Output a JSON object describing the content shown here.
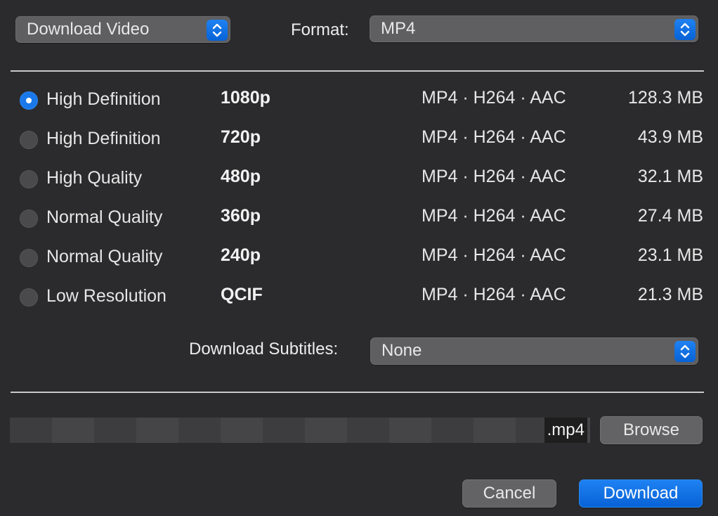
{
  "header": {
    "action_selected": "Download Video",
    "format_label": "Format:",
    "format_selected": "MP4"
  },
  "options": [
    {
      "quality": "High Definition",
      "resolution": "1080p",
      "codec": "MP4 · H264 · AAC",
      "size": "128.3 MB",
      "selected": true
    },
    {
      "quality": "High Definition",
      "resolution": "720p",
      "codec": "MP4 · H264 · AAC",
      "size": "43.9 MB",
      "selected": false
    },
    {
      "quality": "High Quality",
      "resolution": "480p",
      "codec": "MP4 · H264 · AAC",
      "size": "32.1 MB",
      "selected": false
    },
    {
      "quality": "Normal Quality",
      "resolution": "360p",
      "codec": "MP4 · H264 · AAC",
      "size": "27.4 MB",
      "selected": false
    },
    {
      "quality": "Normal Quality",
      "resolution": "240p",
      "codec": "MP4 · H264 · AAC",
      "size": "23.1 MB",
      "selected": false
    },
    {
      "quality": "Low Resolution",
      "resolution": "QCIF",
      "codec": "MP4 · H264 · AAC",
      "size": "21.3 MB",
      "selected": false
    }
  ],
  "subtitles": {
    "label": "Download Subtitles:",
    "selected": "None"
  },
  "file": {
    "extension": ".mp4",
    "browse_label": "Browse"
  },
  "footer": {
    "cancel_label": "Cancel",
    "download_label": "Download"
  },
  "colors": {
    "accent": "#0a6fe4",
    "background": "#2b2b2d"
  },
  "icons": {
    "popup_stepper": "chevron-up-down-icon"
  }
}
